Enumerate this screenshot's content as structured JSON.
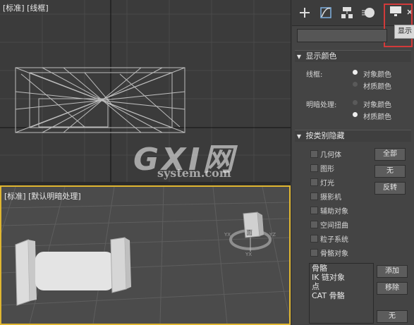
{
  "viewport_top": {
    "label": "[标准] [线框]"
  },
  "viewport_bottom": {
    "label": "[标准] [默认明暗处理]",
    "gizmo_text": "面",
    "gizmo_small": [
      "YX",
      "YZ",
      "YX"
    ]
  },
  "watermark": {
    "logo": "GXI网",
    "url": "system.com"
  },
  "command_panel": {
    "tabs": [
      "create-icon",
      "modify-icon",
      "hierarchy-icon",
      "motion-icon",
      "display-icon",
      "utilities-icon"
    ],
    "tooltip": "显示",
    "display_color": {
      "title": "显示颜色",
      "wireframe_label": "线框:",
      "shaded_label": "明暗处理:",
      "option_object": "对象颜色",
      "option_material": "材质颜色",
      "wireframe_selected": "object",
      "shaded_selected": "material"
    },
    "hide_by_category": {
      "title": "按类别隐藏",
      "items": [
        "几何体",
        "图形",
        "灯光",
        "摄影机",
        "辅助对象",
        "空间扭曲",
        "粒子系统",
        "骨骼对象"
      ],
      "btn_all": "全部",
      "btn_none": "无",
      "btn_invert": "反转",
      "list": [
        "骨骼",
        "IK 链对象",
        "点",
        "CAT 骨骼"
      ],
      "btn_add": "添加",
      "btn_remove": "移除",
      "btn_none_bottom": "无"
    }
  },
  "colors": {
    "active_border": "#e0b630",
    "highlight": "#d23a3a"
  }
}
